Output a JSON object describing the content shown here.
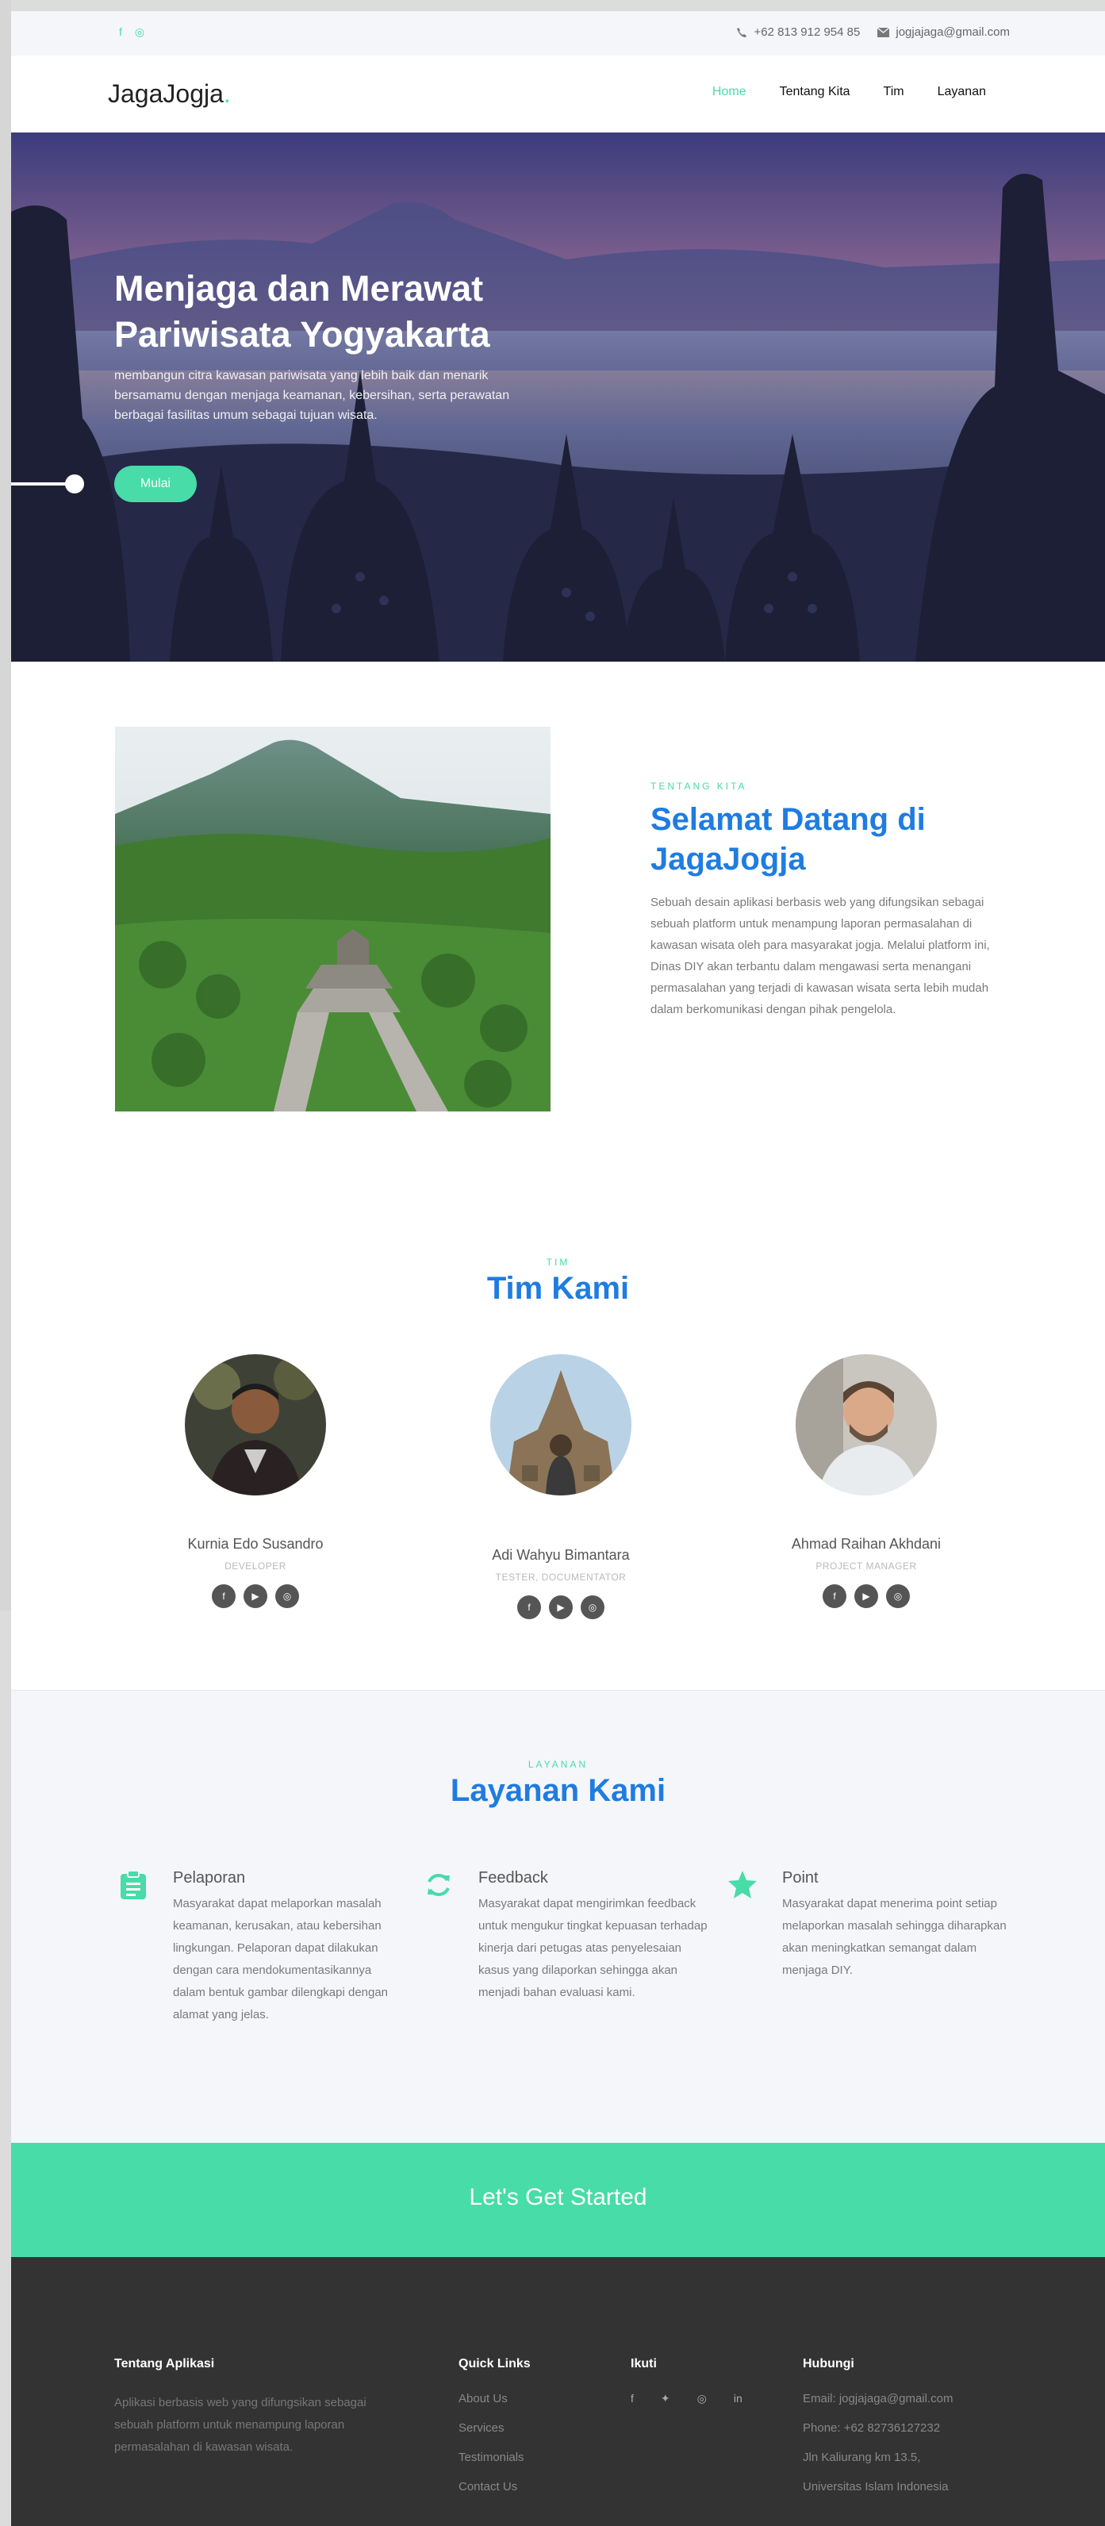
{
  "topbar": {
    "social": [
      {
        "icon": "facebook-icon",
        "glyph": "f"
      },
      {
        "icon": "instagram-icon",
        "glyph": "◎"
      }
    ],
    "phone": "+62 813 912 954 85",
    "email": "jogjajaga@gmail.com"
  },
  "nav": {
    "logo": "JagaJogja",
    "logo_dot": ".",
    "items": [
      {
        "label": "Home",
        "active": true
      },
      {
        "label": "Tentang Kita"
      },
      {
        "label": "Tim"
      },
      {
        "label": "Layanan"
      }
    ]
  },
  "hero": {
    "title": "Menjaga dan Merawat Pariwisata Yogyakarta",
    "subtitle": "membangun citra kawasan pariwisata yang lebih baik dan menarik bersamamu dengan menjaga keamanan, kebersihan, serta perawatan berbagai fasilitas umum sebagai tujuan wisata.",
    "button": "Mulai"
  },
  "about": {
    "eyebrow": "TENTANG KITA",
    "title": "Selamat Datang di JagaJogja",
    "text": "Sebuah desain aplikasi berbasis web yang difungsikan sebagai sebuah platform untuk menampung laporan permasalahan di kawasan wisata oleh para masyarakat jogja. Melalui platform ini, Dinas DIY akan terbantu dalam mengawasi serta menangani permasalahan yang terjadi di kawasan wisata serta lebih mudah dalam berkomunikasi dengan pihak pengelola."
  },
  "team": {
    "eyebrow": "TIM",
    "title": "Tim Kami",
    "members": [
      {
        "name": "Kurnia Edo Susandro",
        "role": "DEVELOPER"
      },
      {
        "name": "Adi Wahyu Bimantara",
        "role": "TESTER, DOCUMENTATOR"
      },
      {
        "name": "Ahmad Raihan Akhdani",
        "role": "PROJECT MANAGER"
      }
    ],
    "social_icons": [
      "facebook-icon",
      "youtube-icon",
      "instagram-icon"
    ]
  },
  "services": {
    "eyebrow": "LAYANAN",
    "title": "Layanan Kami",
    "items": [
      {
        "icon": "clipboard-icon",
        "title": "Pelaporan",
        "text": "Masyarakat dapat melaporkan masalah keamanan, kerusakan, atau kebersihan lingkungan. Pelaporan dapat dilakukan dengan cara mendokumentasikannya dalam bentuk gambar dilengkapi dengan alamat yang jelas."
      },
      {
        "icon": "refresh-icon",
        "title": "Feedback",
        "text": "Masyarakat dapat mengirimkan feedback untuk mengukur tingkat kepuasan terhadap kinerja dari petugas atas penyelesaian kasus yang dilaporkan sehingga akan menjadi bahan evaluasi kami."
      },
      {
        "icon": "star-icon",
        "title": "Point",
        "text": "Masyarakat dapat menerima point setiap melaporkan masalah sehingga diharapkan akan meningkatkan semangat dalam menjaga DIY."
      }
    ]
  },
  "cta": {
    "label": "Let's Get Started"
  },
  "footer": {
    "about_title": "Tentang Aplikasi",
    "about_text": "Aplikasi berbasis web yang difungsikan sebagai sebuah platform untuk menampung laporan permasalahan di kawasan wisata.",
    "links_title": "Quick Links",
    "links": [
      "About Us",
      "Services",
      "Testimonials",
      "Contact Us"
    ],
    "follow_title": "Ikuti",
    "follow_icons": [
      "facebook-icon",
      "twitter-icon",
      "instagram-icon",
      "linkedin-icon"
    ],
    "contact_title": "Hubungi",
    "contact": [
      "Email: jogjajaga@gmail.com",
      "Phone: +62 82736127232",
      "Jln Kaliurang km 13.5,",
      "Universitas Islam Indonesia"
    ]
  },
  "colors": {
    "accent": "#47dca8",
    "title_blue": "#1f7ce0",
    "footer_bg": "#333333"
  }
}
